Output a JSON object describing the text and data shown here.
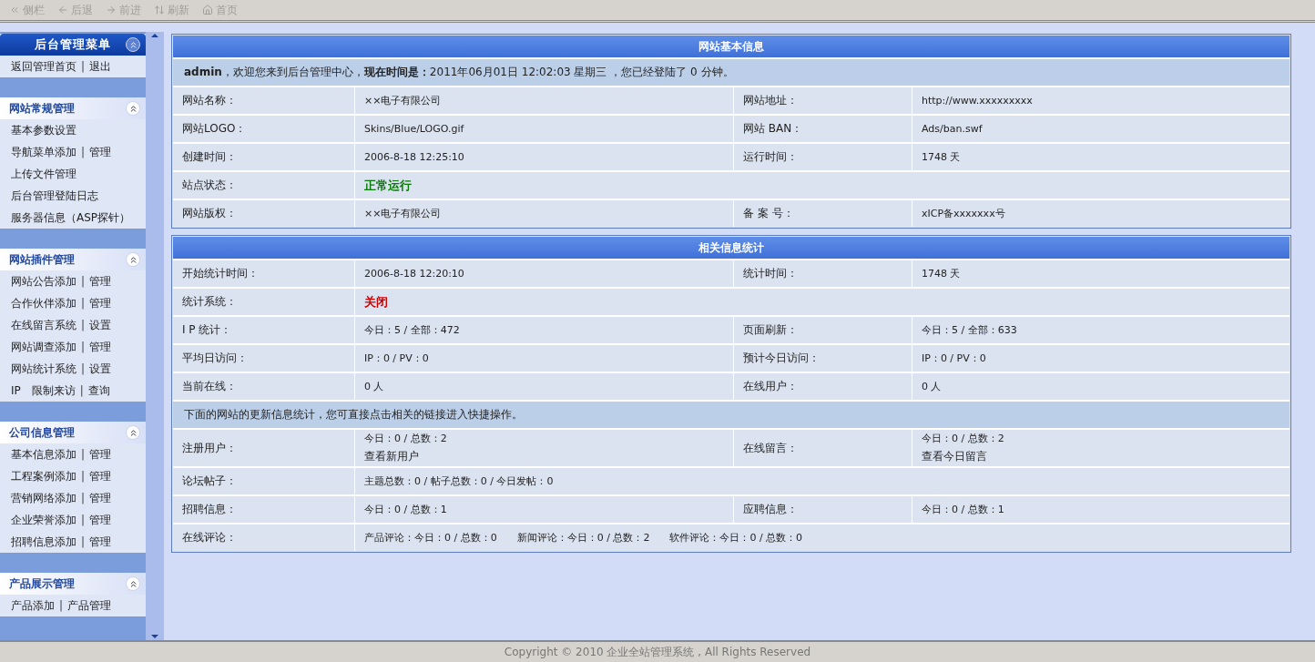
{
  "toolbar": [
    {
      "label": "侧栏",
      "disabled": true
    },
    {
      "label": "后退",
      "disabled": true
    },
    {
      "label": "前进",
      "disabled": true
    },
    {
      "label": "刷新",
      "disabled": true
    },
    {
      "label": "首页",
      "disabled": true
    }
  ],
  "sidebar": {
    "title": "后台管理菜单",
    "top_links": [
      "返回管理首页",
      "|",
      "退出"
    ],
    "sections": [
      {
        "title": "网站常规管理",
        "items": [
          [
            "基本参数设置"
          ],
          [
            "导航菜单添加",
            "|",
            "管理"
          ],
          [
            "上传文件管理"
          ],
          [
            "后台管理登陆日志"
          ],
          [
            "服务器信息（ASP探针）"
          ]
        ]
      },
      {
        "title": "网站插件管理",
        "items": [
          [
            "网站公告添加",
            "|",
            "管理"
          ],
          [
            "合作伙伴添加",
            "|",
            "管理"
          ],
          [
            "在线留言系统",
            "|",
            "设置"
          ],
          [
            "网站调查添加",
            "|",
            "管理"
          ],
          [
            "网站统计系统",
            "|",
            "设置"
          ],
          [
            "IP　限制来访",
            "|",
            "查询"
          ]
        ]
      },
      {
        "title": "公司信息管理",
        "items": [
          [
            "基本信息添加",
            "|",
            "管理"
          ],
          [
            "工程案例添加",
            "|",
            "管理"
          ],
          [
            "营销网络添加",
            "|",
            "管理"
          ],
          [
            "企业荣誉添加",
            "|",
            "管理"
          ],
          [
            "招聘信息添加",
            "|",
            "管理"
          ]
        ]
      },
      {
        "title": "产品展示管理",
        "items": [
          [
            "产品添加",
            "|",
            "产品管理"
          ]
        ]
      }
    ]
  },
  "tables": [
    {
      "title": "网站基本信息",
      "rows": [
        {
          "kind": "notice",
          "text": "**admin**，欢迎您来到后台管理中心，**现在时间是：**2011年06月01日 12:02:03 星期三 ，您已经登陆了 0 分钟。"
        },
        {
          "kind": "pair",
          "cells": [
            {
              "label": "网站名称：",
              "lines": [
                {
                  "text": "××电子有限公司"
                }
              ]
            },
            {
              "label": "网站地址：",
              "lines": [
                {
                  "text": "http://www.xxxxxxxxx"
                }
              ]
            }
          ]
        },
        {
          "kind": "pair",
          "cells": [
            {
              "label": "网站LOGO：",
              "lines": [
                {
                  "text": "Skins/Blue/LOGO.gif"
                }
              ]
            },
            {
              "label": "网站 BAN：",
              "lines": [
                {
                  "text": "Ads/ban.swf"
                }
              ]
            }
          ]
        },
        {
          "kind": "pair",
          "cells": [
            {
              "label": "创建时间：",
              "lines": [
                {
                  "text": "2006-8-18 12:25:10"
                }
              ]
            },
            {
              "label": "运行时间：",
              "lines": [
                {
                  "text": "1748 天"
                }
              ]
            }
          ]
        },
        {
          "kind": "pair",
          "cells": [
            {
              "label": "站点状态：",
              "lines": [
                {
                  "text": "正常运行",
                  "kind": "ok"
                }
              ]
            }
          ]
        },
        {
          "kind": "pair",
          "cells": [
            {
              "label": "网站版权：",
              "lines": [
                {
                  "text": "××电子有限公司"
                }
              ]
            },
            {
              "label": "备 案 号：",
              "lines": [
                {
                  "text": "xICP备xxxxxxx号"
                }
              ]
            }
          ]
        }
      ]
    },
    {
      "title": "相关信息统计",
      "rows": [
        {
          "kind": "pair",
          "cells": [
            {
              "label": "开始统计时间：",
              "lines": [
                {
                  "text": "2006-8-18 12:20:10"
                }
              ]
            },
            {
              "label": "统计时间：",
              "lines": [
                {
                  "text": "1748 天"
                }
              ]
            }
          ]
        },
        {
          "kind": "pair",
          "cells": [
            {
              "label": "统计系统：",
              "lines": [
                {
                  "text": "关闭",
                  "kind": "alert"
                }
              ]
            }
          ]
        },
        {
          "kind": "pair",
          "cells": [
            {
              "label": "I P 统计：",
              "lines": [
                {
                  "text": "今日：5 / 全部：472"
                }
              ]
            },
            {
              "label": "页面刷新：",
              "lines": [
                {
                  "text": "今日：5 / 全部：633"
                }
              ]
            }
          ]
        },
        {
          "kind": "pair",
          "cells": [
            {
              "label": "平均日访问：",
              "lines": [
                {
                  "text": "IP：0 / PV：0"
                }
              ]
            },
            {
              "label": "预计今日访问：",
              "lines": [
                {
                  "text": "IP：0 / PV：0"
                }
              ]
            }
          ]
        },
        {
          "kind": "pair",
          "cells": [
            {
              "label": "当前在线：",
              "lines": [
                {
                  "text": "0 人"
                }
              ]
            },
            {
              "label": "在线用户：",
              "lines": [
                {
                  "text": "0 人"
                }
              ]
            }
          ]
        },
        {
          "kind": "notice",
          "text": "下面的网站的更新信息统计，您可直接点击相关的链接进入快捷操作。"
        },
        {
          "kind": "pair",
          "cells": [
            {
              "label": "注册用户：",
              "lines": [
                {
                  "text": "今日：0 / 总数：2"
                },
                {
                  "text": "查看新用户",
                  "kind": "link"
                }
              ]
            },
            {
              "label": "在线留言：",
              "lines": [
                {
                  "text": "今日：0 / 总数：2"
                },
                {
                  "text": "查看今日留言",
                  "kind": "link"
                }
              ]
            }
          ]
        },
        {
          "kind": "pair",
          "cells": [
            {
              "label": "论坛帖子：",
              "lines": [
                {
                  "text": "主题总数：0 / 帖子总数：0 / 今日发帖：0"
                }
              ]
            }
          ]
        },
        {
          "kind": "pair",
          "cells": [
            {
              "label": "招聘信息：",
              "lines": [
                {
                  "text": "今日：0 / 总数：1"
                }
              ]
            },
            {
              "label": "应聘信息：",
              "lines": [
                {
                  "text": "今日：0 / 总数：1"
                }
              ]
            }
          ]
        },
        {
          "kind": "pair",
          "cells": [
            {
              "label": "在线评论：",
              "lines": [
                {
                  "text": "产品评论：今日：0 / 总数：0　　新闻评论：今日：0 / 总数：2　　软件评论：今日：0 / 总数：0"
                }
              ]
            }
          ]
        }
      ]
    }
  ],
  "footer": "Copyright © 2010 企业全站管理系统 , All Rights Reserved"
}
